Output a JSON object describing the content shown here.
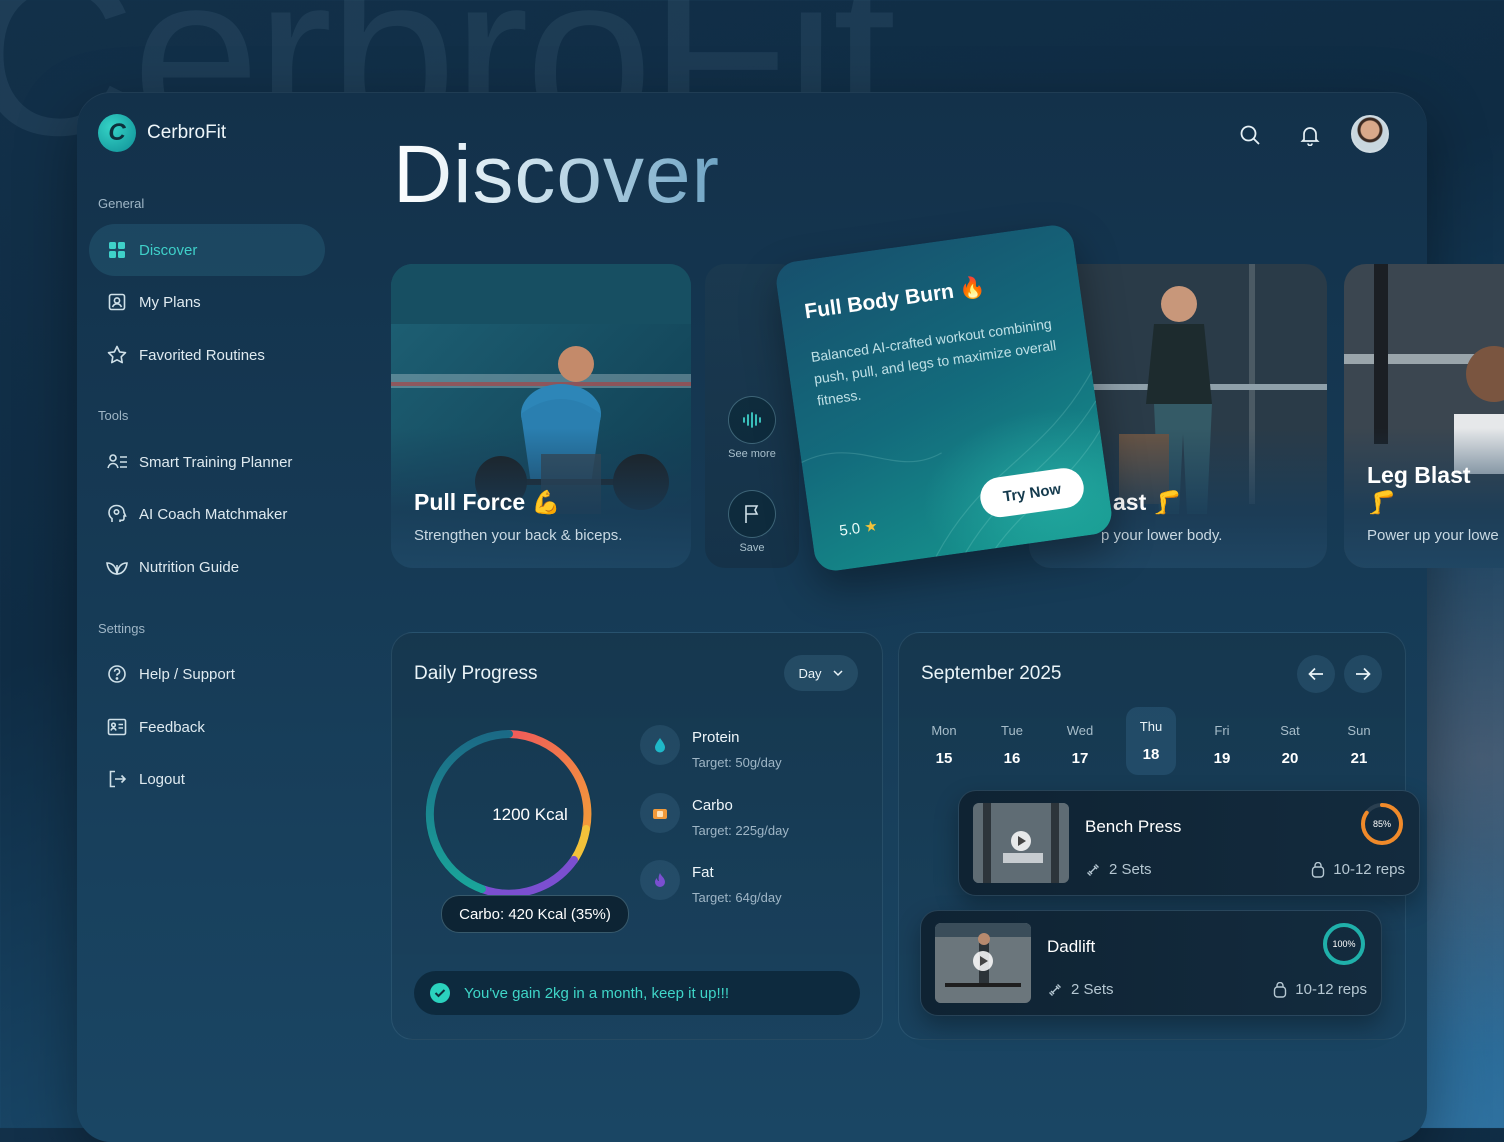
{
  "app": {
    "name": "CerbroFit",
    "watermark": "CerbroFit"
  },
  "page": {
    "title": "Discover"
  },
  "sidebar": {
    "sections": [
      {
        "label": "General",
        "items": [
          {
            "label": "Discover",
            "icon": "grid-icon",
            "active": true
          },
          {
            "label": "My Plans",
            "icon": "plan-icon"
          },
          {
            "label": "Favorited Routines",
            "icon": "star-icon"
          }
        ]
      },
      {
        "label": "Tools",
        "items": [
          {
            "label": "Smart Training Planner",
            "icon": "planner-icon"
          },
          {
            "label": "AI Coach Matchmaker",
            "icon": "coach-icon"
          },
          {
            "label": "Nutrition Guide",
            "icon": "leaf-icon"
          }
        ]
      },
      {
        "label": "Settings",
        "items": [
          {
            "label": "Help / Support",
            "icon": "help-icon"
          },
          {
            "label": "Feedback",
            "icon": "feedback-icon"
          },
          {
            "label": "Logout",
            "icon": "logout-icon"
          }
        ]
      }
    ]
  },
  "topbar": {
    "search_icon": "search-icon",
    "bell_icon": "bell-icon",
    "avatar": "user-avatar"
  },
  "workouts": [
    {
      "title": "Pull Force 💪",
      "subtitle": "Strengthen your back & biceps."
    },
    {
      "title": "ast 🦵",
      "subtitle": "p your lower body."
    },
    {
      "title": "Leg Blast 🦵",
      "subtitle": "Power up your lowe"
    }
  ],
  "featured": {
    "title": "Full Body Burn 🔥",
    "description": "Balanced AI-crafted workout combining push, pull, and legs to maximize overall fitness.",
    "rating": "5.0",
    "cta": "Try Now"
  },
  "actions": {
    "see_more": "See more",
    "save": "Save"
  },
  "daily_progress": {
    "title": "Daily Progress",
    "period": "Day",
    "total": "1200 Kcal",
    "tooltip": "Carbo: 420 Kcal (35%)",
    "ring_colors": [
      "#1aa59a",
      "#f05a5a",
      "#f29a3a",
      "#f2c23a",
      "#7b4fd0"
    ],
    "macros": [
      {
        "name": "Protein",
        "target": "Target: 50g/day",
        "color": "#1fb8c8"
      },
      {
        "name": "Carbo",
        "target": "Target: 225g/day",
        "color": "#f29a3a"
      },
      {
        "name": "Fat",
        "target": "Target: 64g/day",
        "color": "#7b4fd0"
      }
    ],
    "message": "You've gain 2kg in a month, keep it up!!!"
  },
  "calendar": {
    "month": "September 2025",
    "days": [
      {
        "name": "Mon",
        "date": "15"
      },
      {
        "name": "Tue",
        "date": "16"
      },
      {
        "name": "Wed",
        "date": "17"
      },
      {
        "name": "Thu",
        "date": "18",
        "selected": true
      },
      {
        "name": "Fri",
        "date": "19"
      },
      {
        "name": "Sat",
        "date": "20"
      },
      {
        "name": "Sun",
        "date": "21"
      }
    ],
    "exercises": [
      {
        "name": "Bench Press",
        "sets": "2 Sets",
        "reps": "10-12 reps",
        "progress_label": "85%",
        "progress": 0.85,
        "color": "#f08a2a"
      },
      {
        "name": "Dadlift",
        "sets": "2 Sets",
        "reps": "10-12 reps",
        "progress_label": "100%",
        "progress": 1.0,
        "color": "#1fb0aa"
      }
    ]
  }
}
